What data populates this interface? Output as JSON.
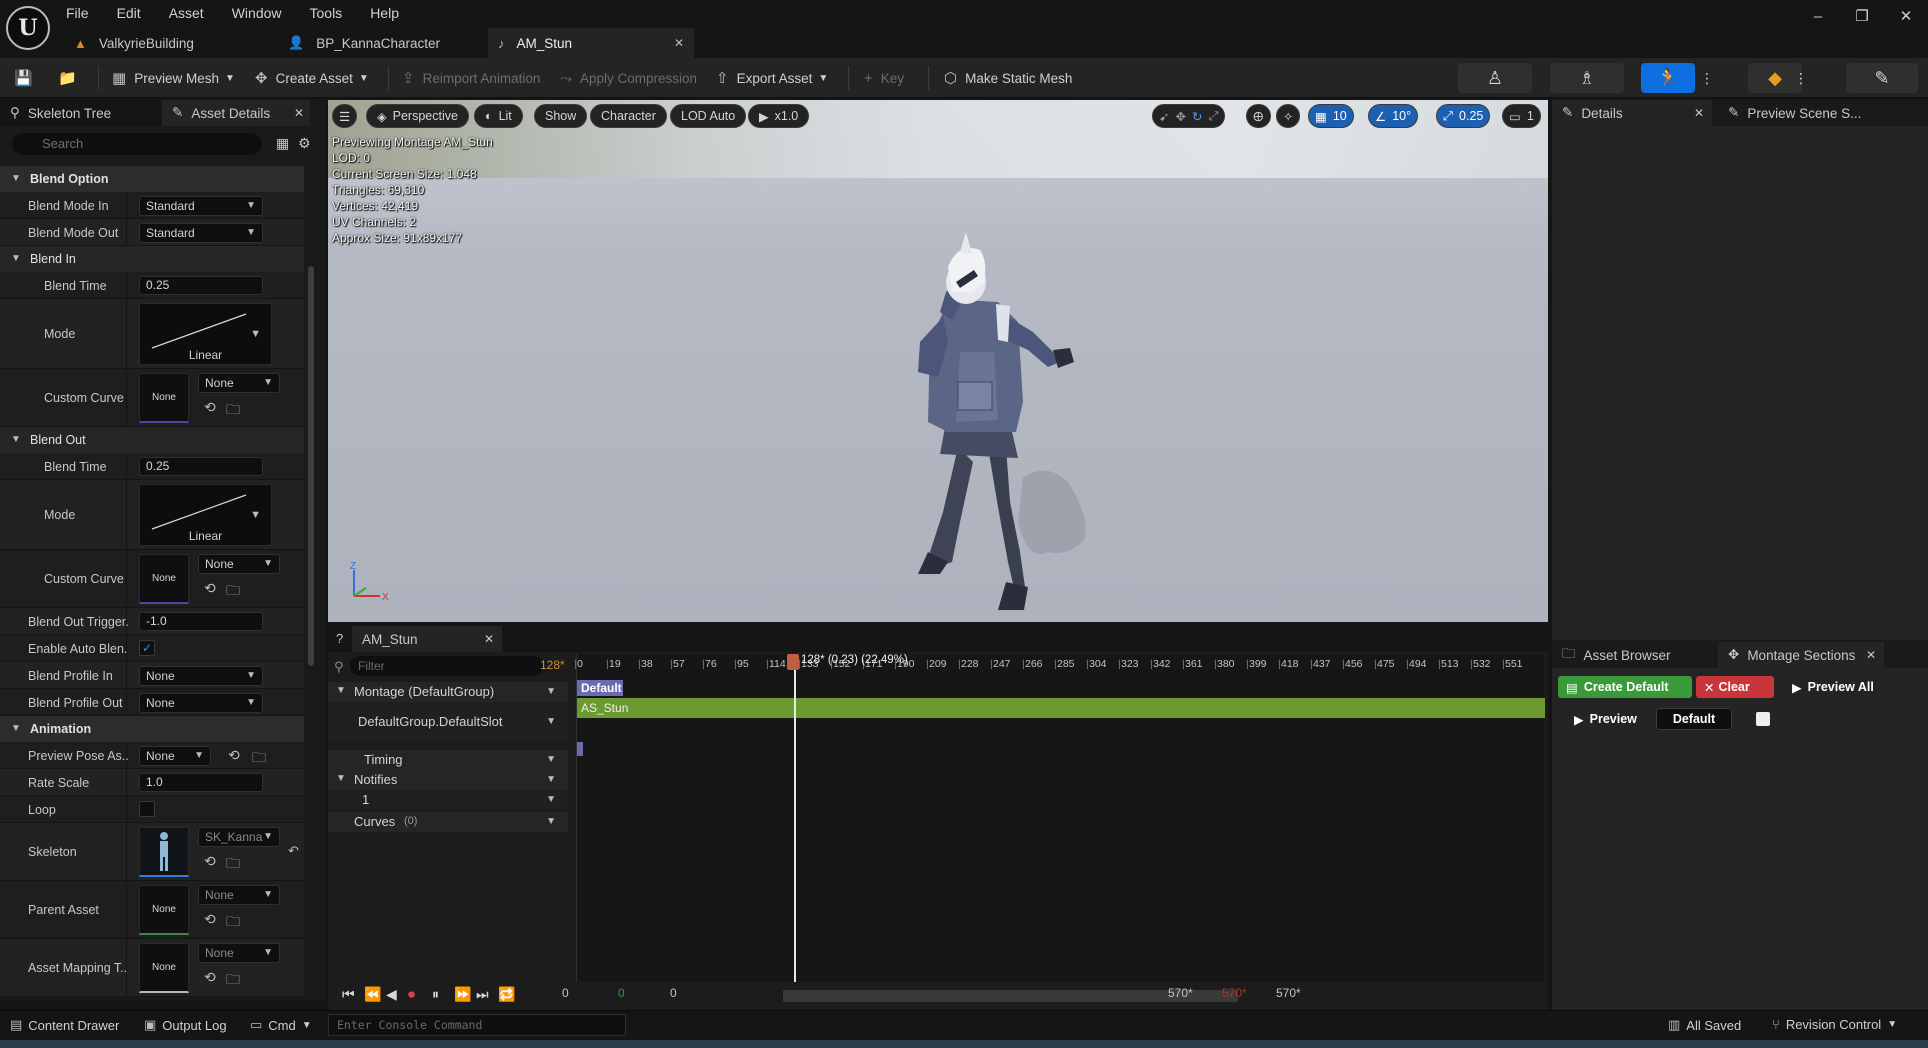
{
  "menu": [
    "File",
    "Edit",
    "Asset",
    "Window",
    "Tools",
    "Help"
  ],
  "doc_tabs": [
    {
      "label": "ValkyrieBuilding",
      "icon": "triangle-warning-icon"
    },
    {
      "label": "BP_KannaCharacter",
      "icon": "person-icon"
    },
    {
      "label": "AM_Stun",
      "icon": "montage-icon"
    }
  ],
  "window_controls": [
    "–",
    "❐",
    "✕"
  ],
  "toolbar": {
    "preview_mesh": "Preview Mesh",
    "create_asset": "Create Asset",
    "reimport_animation": "Reimport Animation",
    "apply_compression": "Apply Compression",
    "export_asset": "Export Asset",
    "key": "Key",
    "make_static_mesh": "Make Static Mesh"
  },
  "left_panel": {
    "tab_skeleton_tree": "Skeleton Tree",
    "tab_asset_details": "Asset Details",
    "search_placeholder": "Search",
    "sections": {
      "blend_option": "Blend Option",
      "blend_in": "Blend In",
      "blend_out": "Blend Out",
      "animation": "Animation"
    },
    "props": {
      "blend_mode_in": {
        "label": "Blend Mode In",
        "value": "Standard"
      },
      "blend_mode_out": {
        "label": "Blend Mode Out",
        "value": "Standard"
      },
      "blend_in_time": {
        "label": "Blend Time",
        "value": "0.25"
      },
      "blend_in_mode": {
        "label": "Mode",
        "value": "Linear"
      },
      "blend_in_curve": {
        "label": "Custom Curve",
        "thumb": "None",
        "value": "None"
      },
      "blend_out_time": {
        "label": "Blend Time",
        "value": "0.25"
      },
      "blend_out_mode": {
        "label": "Mode",
        "value": "Linear"
      },
      "blend_out_curve": {
        "label": "Custom Curve",
        "thumb": "None",
        "value": "None"
      },
      "blend_out_trigger": {
        "label": "Blend Out Trigger...",
        "value": "-1.0"
      },
      "enable_auto_blend": {
        "label": "Enable Auto Blen..."
      },
      "blend_profile_in": {
        "label": "Blend Profile In",
        "value": "None"
      },
      "blend_profile_out": {
        "label": "Blend Profile Out",
        "value": "None"
      },
      "preview_pose": {
        "label": "Preview Pose As...",
        "value": "None"
      },
      "rate_scale": {
        "label": "Rate Scale",
        "value": "1.0"
      },
      "loop": {
        "label": "Loop"
      },
      "skeleton": {
        "label": "Skeleton",
        "value": "SK_Kanna"
      },
      "parent_asset": {
        "label": "Parent Asset",
        "thumb": "None",
        "value": "None"
      },
      "asset_mapping": {
        "label": "Asset Mapping T...",
        "thumb": "None",
        "value": "None"
      }
    }
  },
  "viewport": {
    "perspective": "Perspective",
    "lit": "Lit",
    "show": "Show",
    "character": "Character",
    "lod": "LOD Auto",
    "speed": "x1.0",
    "grid_value": "10",
    "angle_value": "10°",
    "scale_value": "0.25",
    "camera_value": "1",
    "info": [
      "Previewing Montage AM_Stun",
      "LOD: 0",
      "Current Screen Size: 1.048",
      "Triangles: 69,310",
      "Vertices: 42,419",
      "UV Channels: 2",
      "Approx Size: 91x89x177"
    ],
    "axis_z": "Z",
    "axis_x": "X"
  },
  "details_panel": {
    "tab_details": "Details",
    "tab_preview_scene": "Preview Scene S..."
  },
  "montage_panel": {
    "tab_asset_browser": "Asset Browser",
    "tab_montage_sections": "Montage Sections",
    "create_default": "Create Default",
    "clear": "Clear",
    "preview_all": "Preview All",
    "preview": "Preview",
    "default_section": "Default"
  },
  "sequencer": {
    "tab": "AM_Stun",
    "filter_placeholder": "Filter",
    "frame_count": "128*",
    "tracks": {
      "montage": "Montage (DefaultGroup)",
      "slot": "DefaultGroup.DefaultSlot",
      "timing": "Timing",
      "notifies": "Notifies",
      "notify_track": "1",
      "curves": "Curves",
      "curves_count": "(0)"
    },
    "section_label": "Default",
    "segment_label": "AS_Stun",
    "playhead_label": "128* (0.23) (22.49%)",
    "ruler_ticks": [
      "0",
      "19",
      "38",
      "57",
      "76",
      "95",
      "114",
      "133",
      "152",
      "171",
      "190",
      "209",
      "228",
      "247",
      "266",
      "285",
      "304",
      "323",
      "342",
      "361",
      "380",
      "399",
      "418",
      "437",
      "456",
      "475",
      "494",
      "513",
      "532",
      "551"
    ],
    "start_a": "0",
    "start_b": "0",
    "start_c": "0",
    "end_a": "570*",
    "end_b": "570*",
    "end_c": "570*"
  },
  "statusbar": {
    "content_drawer": "Content Drawer",
    "output_log": "Output Log",
    "cmd": "Cmd",
    "console_placeholder": "Enter Console Command",
    "all_saved": "All Saved",
    "revision_control": "Revision Control"
  },
  "colors": {
    "accent_blue": "#0e70e0",
    "segment_green": "#6a9a30",
    "create_default_green": "#3a9a3a",
    "clear_red": "#c8363a"
  }
}
